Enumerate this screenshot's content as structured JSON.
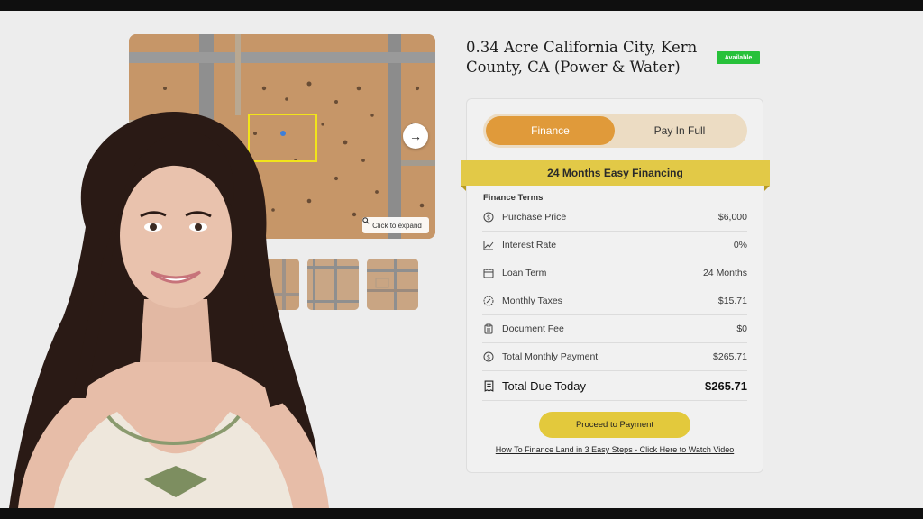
{
  "listing": {
    "title": "0.34 Acre California City, Kern County, CA (Power & Water)",
    "status_badge": "Available"
  },
  "gallery": {
    "expand_label": "Click to expand",
    "next_icon": "arrow-right-icon",
    "thumbnail_count": 3
  },
  "payment_toggle": {
    "finance_label": "Finance",
    "pay_in_full_label": "Pay In Full",
    "selected": "Finance"
  },
  "financing_banner": "24 Months Easy Financing",
  "finance_terms": {
    "heading": "Finance Terms",
    "rows": [
      {
        "icon": "dollar-circle-icon",
        "label": "Purchase Price",
        "value": "$6,000"
      },
      {
        "icon": "chart-line-icon",
        "label": "Interest Rate",
        "value": "0%"
      },
      {
        "icon": "calendar-icon",
        "label": "Loan Term",
        "value": "24 Months"
      },
      {
        "icon": "percent-badge-icon",
        "label": "Monthly Taxes",
        "value": "$15.71"
      },
      {
        "icon": "clipboard-icon",
        "label": "Document Fee",
        "value": "$0"
      },
      {
        "icon": "dollar-circle-icon",
        "label": "Total Monthly Payment",
        "value": "$265.71"
      }
    ],
    "total": {
      "icon": "receipt-icon",
      "label": "Total Due Today",
      "value": "$265.71"
    }
  },
  "actions": {
    "proceed_label": "Proceed to Payment",
    "video_link": "How To Finance Land in 3 Easy Steps - Click Here to Watch Video"
  },
  "colors": {
    "accent_orange": "#e09a3a",
    "accent_yellow": "#e3c93c",
    "available_green": "#27c13a"
  }
}
